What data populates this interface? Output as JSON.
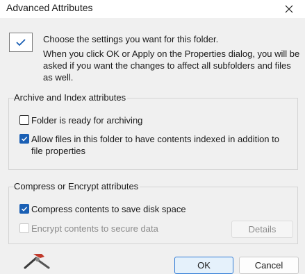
{
  "dialog": {
    "title": "Advanced Attributes"
  },
  "intro": {
    "line1": "Choose the settings you want for this folder.",
    "paragraph": "When you click OK or Apply on the Properties dialog, you will be asked if you want the changes to affect all subfolders and files as well."
  },
  "archive_group": {
    "label": "Archive and Index attributes",
    "items": [
      {
        "label": "Folder is ready for archiving",
        "checked": false
      },
      {
        "label": "Allow files in this folder to have contents indexed in addition to file properties",
        "checked": true
      }
    ]
  },
  "compress_group": {
    "label": "Compress or Encrypt attributes",
    "items": [
      {
        "label": "Compress contents to save disk space",
        "checked": true,
        "enabled": true
      },
      {
        "label": "Encrypt contents to secure data",
        "checked": false,
        "enabled": false
      }
    ],
    "details_label": "Details"
  },
  "buttons": {
    "ok": "OK",
    "cancel": "Cancel"
  },
  "colors": {
    "accent": "#1a5fb4",
    "ok_border": "#2f7bd6",
    "background": "#f0f0f0"
  },
  "icons": [
    "close-icon",
    "folder-checkmark-icon",
    "checkmark-icon",
    "wrench-hammer-icon"
  ]
}
